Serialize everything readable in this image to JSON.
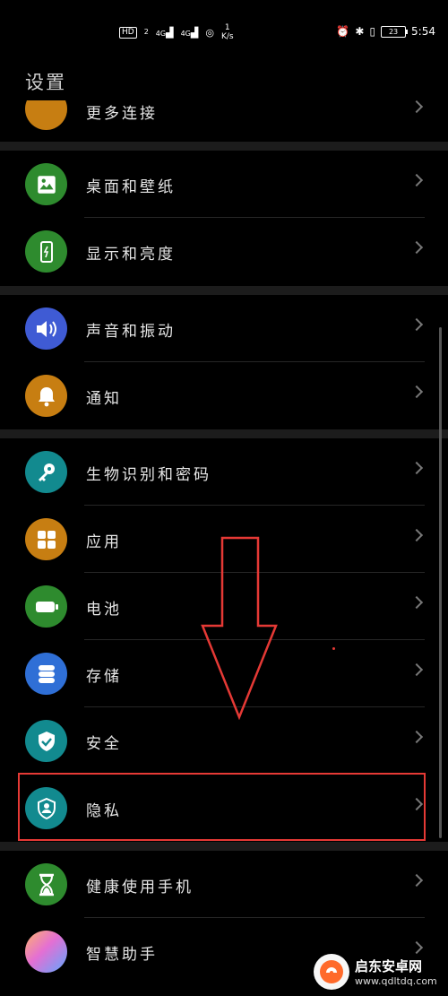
{
  "status_bar": {
    "hd_label": "HD",
    "sim_label": "2",
    "net1": "4G",
    "net2": "4G",
    "speed_value": "1",
    "speed_unit": "K/s",
    "battery_level": "23",
    "time": "5:54"
  },
  "page": {
    "title": "设置"
  },
  "partial_item": {
    "label": "更多连接"
  },
  "groups": [
    {
      "items": [
        {
          "label": "桌面和壁纸",
          "icon": "wallpaper-icon",
          "color": "#2e8b2e"
        },
        {
          "label": "显示和亮度",
          "icon": "display-icon",
          "color": "#2e8b2e"
        }
      ]
    },
    {
      "items": [
        {
          "label": "声音和振动",
          "icon": "sound-icon",
          "color": "#3f5bd4"
        },
        {
          "label": "通知",
          "icon": "bell-icon",
          "color": "#c77e12"
        }
      ]
    },
    {
      "items": [
        {
          "label": "生物识别和密码",
          "icon": "key-icon",
          "color": "#128a8f"
        },
        {
          "label": "应用",
          "icon": "apps-icon",
          "color": "#c77e12"
        },
        {
          "label": "电池",
          "icon": "battery-icon",
          "color": "#2e8b2e"
        },
        {
          "label": "存储",
          "icon": "storage-icon",
          "color": "#2f6fd6"
        },
        {
          "label": "安全",
          "icon": "shield-check-icon",
          "color": "#128a8f"
        },
        {
          "label": "隐私",
          "icon": "privacy-icon",
          "color": "#128a8f"
        }
      ]
    },
    {
      "items": [
        {
          "label": "健康使用手机",
          "icon": "hourglass-icon",
          "color": "#2e8b2e"
        },
        {
          "label": "智慧助手",
          "icon": "assistant-icon",
          "color": "#9b6bd6"
        }
      ]
    }
  ],
  "watermark": {
    "cn": "启东安卓网",
    "url": "www.qdltdq.com"
  }
}
